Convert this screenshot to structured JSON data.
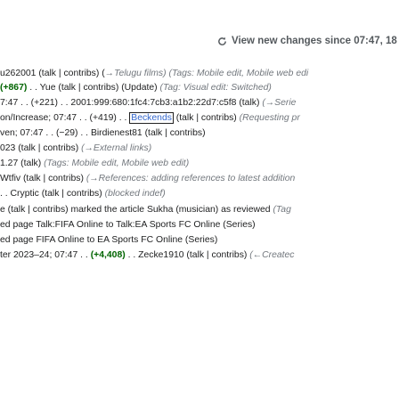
{
  "banner": {
    "text": "View new changes since 07:47, 18 Ja"
  },
  "lines": [
    [
      {
        "t": "u262001 ",
        "c": "text"
      },
      {
        "t": "(talk",
        "c": "text"
      },
      {
        "t": " | ",
        "c": "text"
      },
      {
        "t": "contribs)",
        "c": "text"
      },
      {
        "t": " (",
        "c": "text"
      },
      {
        "t": "→Telugu films)",
        "c": "it"
      },
      {
        "t": " (Tags: Mobile edit, Mobile web edi",
        "c": "it"
      }
    ],
    [
      {
        "t": "  ",
        "c": "text"
      },
      {
        "t": "(+867)",
        "c": "pos"
      },
      {
        "t": " . . Yue (talk | contribs) (Update) ",
        "c": "text"
      },
      {
        "t": "(Tag: Visual edit: Switched)",
        "c": "it"
      }
    ],
    [
      {
        "t": "7:47 . . (+221) . . 2001:999:680:1fc4:7cb3:a1b2:22d7:c5f8 (talk) ",
        "c": "text"
      },
      {
        "t": "(→Serie",
        "c": "it"
      }
    ],
    [
      {
        "t": "on/Increase; 07:47 . . (+419) . . ",
        "c": "text"
      },
      {
        "t": "Beckends",
        "c": "boxed"
      },
      {
        "t": " (talk | contribs) ",
        "c": "text"
      },
      {
        "t": "(Requesting pr",
        "c": "it"
      }
    ],
    [
      {
        "t": "ven; 07:47 . . (−29) . . Birdienest81 (talk | contribs)",
        "c": "text"
      }
    ],
    [
      {
        "t": "023 (talk | contribs) ",
        "c": "text"
      },
      {
        "t": "(→External links)",
        "c": "it"
      }
    ],
    [
      {
        "t": "1.27 (talk) ",
        "c": "text"
      },
      {
        "t": "(Tags: Mobile edit, Mobile web edit)",
        "c": "it"
      }
    ],
    [
      {
        "t": "Wtfiv (talk | contribs) ",
        "c": "text"
      },
      {
        "t": "(→References: adding references to latest addition",
        "c": "it"
      }
    ],
    [
      {
        "t": ". . Cryptic (talk | contribs) ",
        "c": "text"
      },
      {
        "t": "(blocked indef)",
        "c": "it"
      }
    ],
    [
      {
        "t": "e (talk | contribs) marked the article Sukha (musician) as reviewed ",
        "c": "text"
      },
      {
        "t": "(Tag",
        "c": "it"
      }
    ],
    [
      {
        "t": "ed page Talk:FIFA Online to Talk:EA Sports FC Online (Series)",
        "c": "text"
      }
    ],
    [
      {
        "t": "ed page FIFA Online to EA Sports FC Online (Series)",
        "c": "text"
      }
    ],
    [
      {
        "t": "ter 2023–24; 07:47 . . ",
        "c": "text"
      },
      {
        "t": "(+4,408)",
        "c": "pos"
      },
      {
        "t": " . . Zecke1910 (talk | contribs) ",
        "c": "text"
      },
      {
        "t": "(←Createc",
        "c": "it"
      }
    ]
  ]
}
